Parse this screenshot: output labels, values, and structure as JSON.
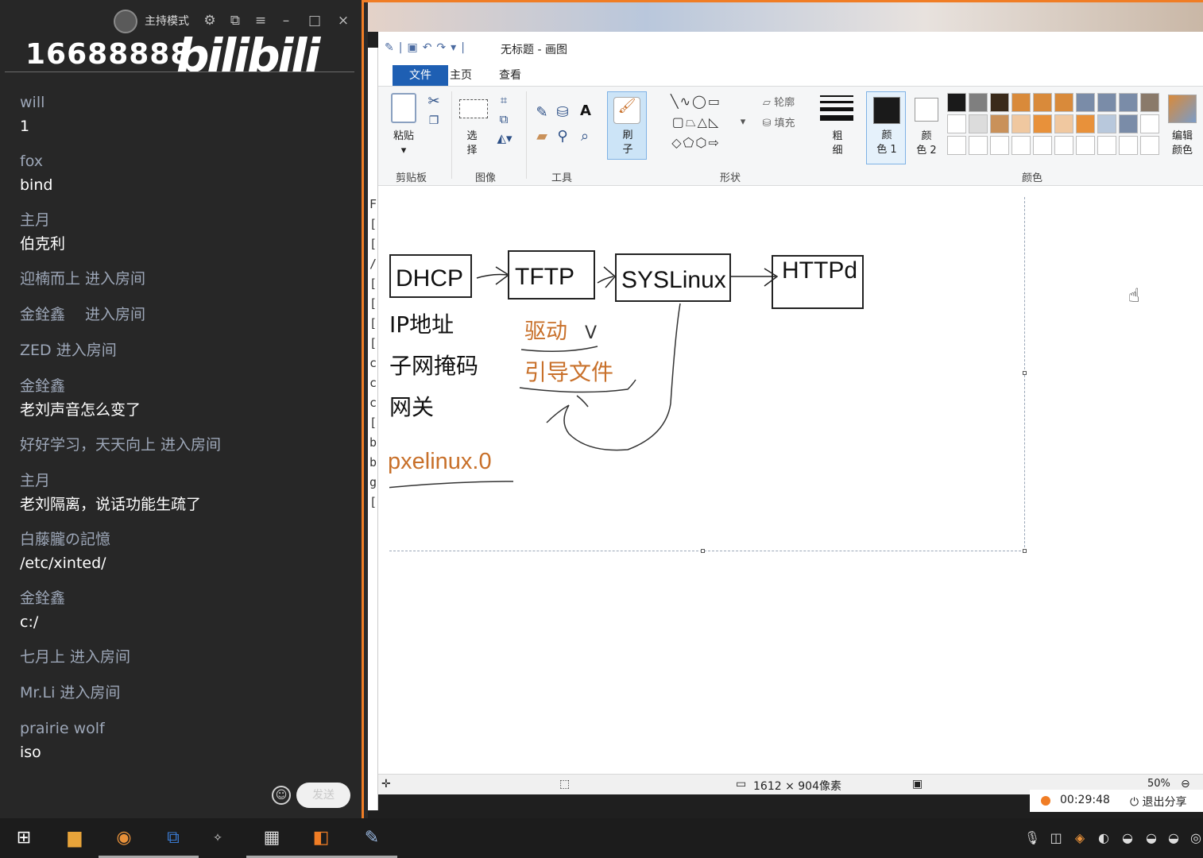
{
  "chat": {
    "host_mode": "主持模式",
    "room_number": "16688888",
    "brand": "bilibili",
    "messages": [
      {
        "user": "will",
        "text": "1"
      },
      {
        "user": "fox",
        "text": "bind"
      },
      {
        "user": "主月",
        "text": "伯克利"
      },
      {
        "user": "迎楠而上 进入房间",
        "text": ""
      },
      {
        "user": "金銓鑫　 进入房间",
        "text": ""
      },
      {
        "user": "ZED 进入房间",
        "text": ""
      },
      {
        "user": "金銓鑫",
        "text": "老刘声音怎么变了"
      },
      {
        "user": "好好学习，天天向上 进入房间",
        "text": ""
      },
      {
        "user": "主月",
        "text": "老刘隔离，说话功能生疏了"
      },
      {
        "user": "白藤朧の記憶",
        "text": "/etc/xinted/"
      },
      {
        "user": "金銓鑫",
        "text": "c:/"
      },
      {
        "user": "七月上 进入房间",
        "text": ""
      },
      {
        "user": "Mr.Li 进入房间",
        "text": ""
      },
      {
        "user": "prairie wolf",
        "text": "iso"
      }
    ],
    "send_label": "发送",
    "emoji_icon": "smiley-icon"
  },
  "paint": {
    "title": "无标题 - 画图",
    "tabs": [
      "文件",
      "主页",
      "查看"
    ],
    "groups": {
      "clipboard": "剪贴板",
      "image": "图像",
      "tools": "工具",
      "shapes": "形状",
      "colors": "颜色"
    },
    "labels": {
      "paste": "粘贴",
      "select": "选\n择",
      "brush": "刷\n子",
      "outline": "轮廓",
      "fill": "填充",
      "size": "粗\n细",
      "color1": "颜\n色 1",
      "color2": "颜\n色 2",
      "edit_colors": "编辑\n颜色"
    },
    "palette": [
      "#1a1a1a",
      "#7f7f7f",
      "#3a2a1a",
      "#d98a3a",
      "#d98a3a",
      "#d98a3a",
      "#7a8ca8",
      "#7a8ca8",
      "#7a8ca8",
      "#8a7a6a",
      "#ffffff",
      "#dcdcdc",
      "#c9915a",
      "#f0c8a0",
      "#e8913a",
      "#f0c8a0",
      "#e8913a",
      "#b8c8dc",
      "#7a8ca8",
      "#ffffff",
      "#ffffff",
      "#ffffff",
      "#ffffff",
      "#ffffff",
      "#ffffff",
      "#ffffff",
      "#ffffff",
      "#ffffff",
      "#ffffff",
      "#ffffff"
    ],
    "drawing": {
      "boxes": [
        "DHCP",
        "TFTP",
        "SYSLinux",
        "HTTPd"
      ],
      "left_notes": [
        "IP地址",
        "子网掩码",
        "网关"
      ],
      "orange_notes": [
        "驱动",
        "引导文件"
      ],
      "check_mark": "V",
      "bottom_note": "pxelinux.0"
    },
    "status": {
      "dimensions": "1612 × 904像素",
      "zoom": "50%"
    }
  },
  "share": {
    "time": "00:29:48",
    "exit_label": "退出分享"
  },
  "colors": {
    "accent": "#f07d25",
    "chat_bg": "#272727",
    "username": "#9da7b8",
    "ribbon_blue": "#1e5fb3",
    "ink_orange": "#c8702a"
  }
}
